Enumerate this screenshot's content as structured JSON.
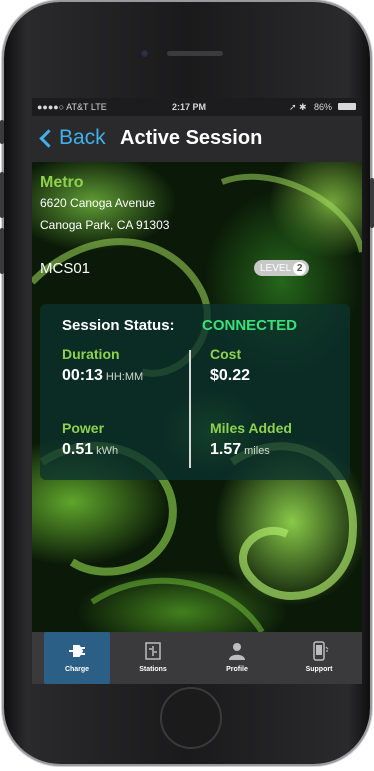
{
  "status_bar": {
    "carrier": "●●●●○ AT&T  LTE",
    "time": "2:17 PM",
    "battery": "86%"
  },
  "nav": {
    "back_label": "Back",
    "title": "Active Session"
  },
  "station": {
    "name": "Metro",
    "address_line1": "6620 Canoga Avenue",
    "address_line2": "Canoga Park, CA 91303",
    "id": "MCS01",
    "level_label": "LEVEL",
    "level_num": "2"
  },
  "session": {
    "status_label": "Session Status:",
    "status_value": "CONNECTED",
    "duration_label": "Duration",
    "duration_value": "00:13",
    "duration_unit": "HH:MM",
    "cost_label": "Cost",
    "cost_value": "$0.22",
    "power_label": "Power",
    "power_value": "0.51",
    "power_unit": "kWh",
    "miles_label": "Miles Added",
    "miles_value": "1.57",
    "miles_unit": "miles"
  },
  "tabs": [
    {
      "label": "Charge",
      "icon": "plug-icon",
      "active": true
    },
    {
      "label": "Stations",
      "icon": "map-icon",
      "active": false
    },
    {
      "label": "Profile",
      "icon": "person-icon",
      "active": false
    },
    {
      "label": "Support",
      "icon": "phone-icon",
      "active": false
    }
  ],
  "colors": {
    "accent_green": "#8fd14f",
    "status_green": "#39e07a",
    "link_blue": "#3fb0ea",
    "tab_active": "#2b5f85"
  }
}
